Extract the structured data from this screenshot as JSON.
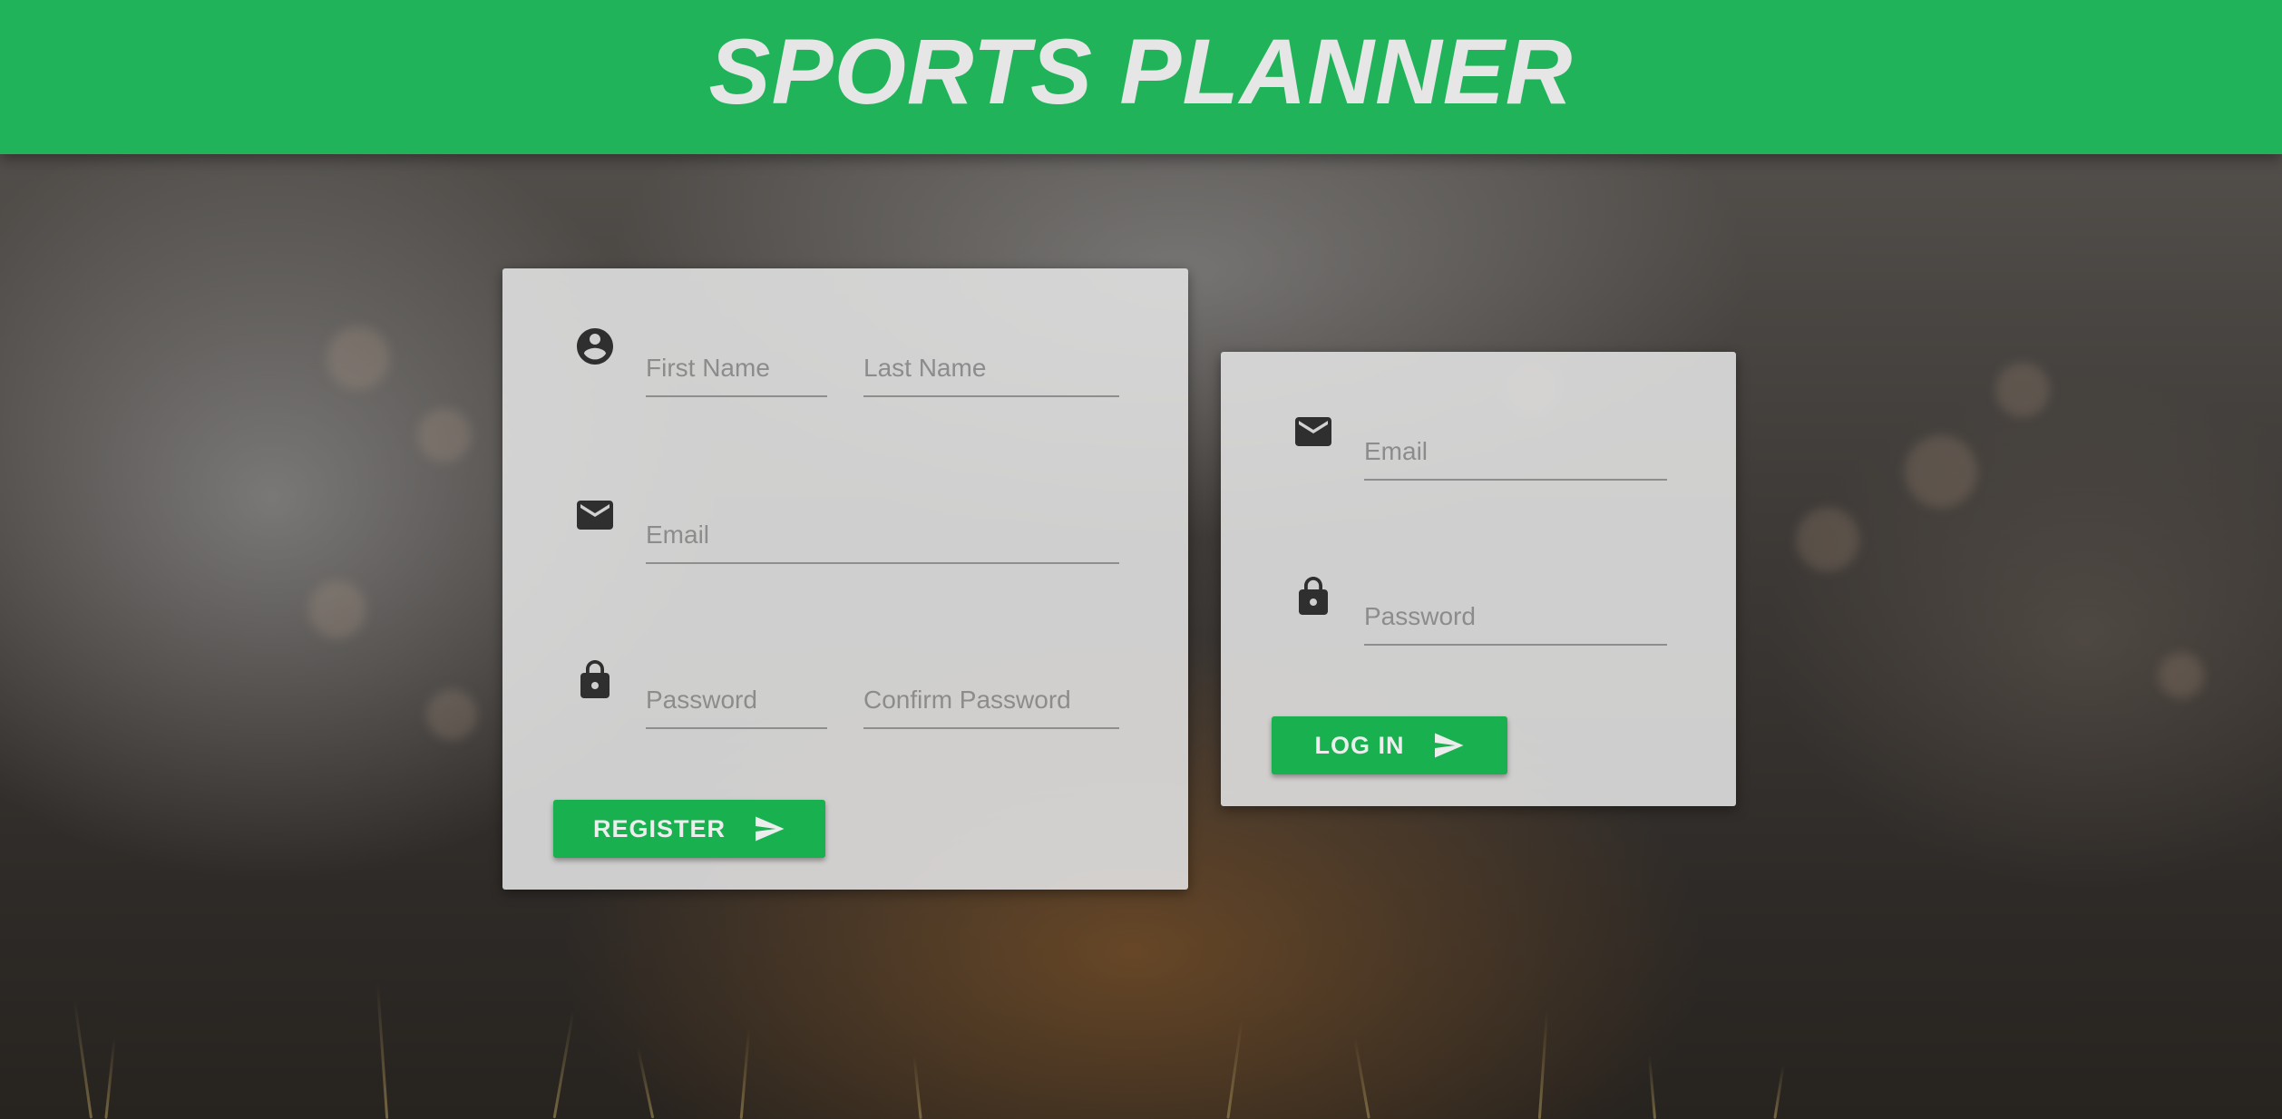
{
  "app": {
    "title": "SPORTS PLANNER",
    "accent_color": "#21b35a",
    "button_color": "#19b04f"
  },
  "register": {
    "first_name_placeholder": "First Name",
    "last_name_placeholder": "Last Name",
    "email_placeholder": "Email",
    "password_placeholder": "Password",
    "confirm_password_placeholder": "Confirm Password",
    "button_label": "REGISTER",
    "icons": [
      "account-circle-icon",
      "mail-icon",
      "lock-icon",
      "send-icon"
    ]
  },
  "login": {
    "email_placeholder": "Email",
    "password_placeholder": "Password",
    "button_label": "LOG IN",
    "icons": [
      "mail-icon",
      "lock-icon",
      "send-icon"
    ]
  }
}
